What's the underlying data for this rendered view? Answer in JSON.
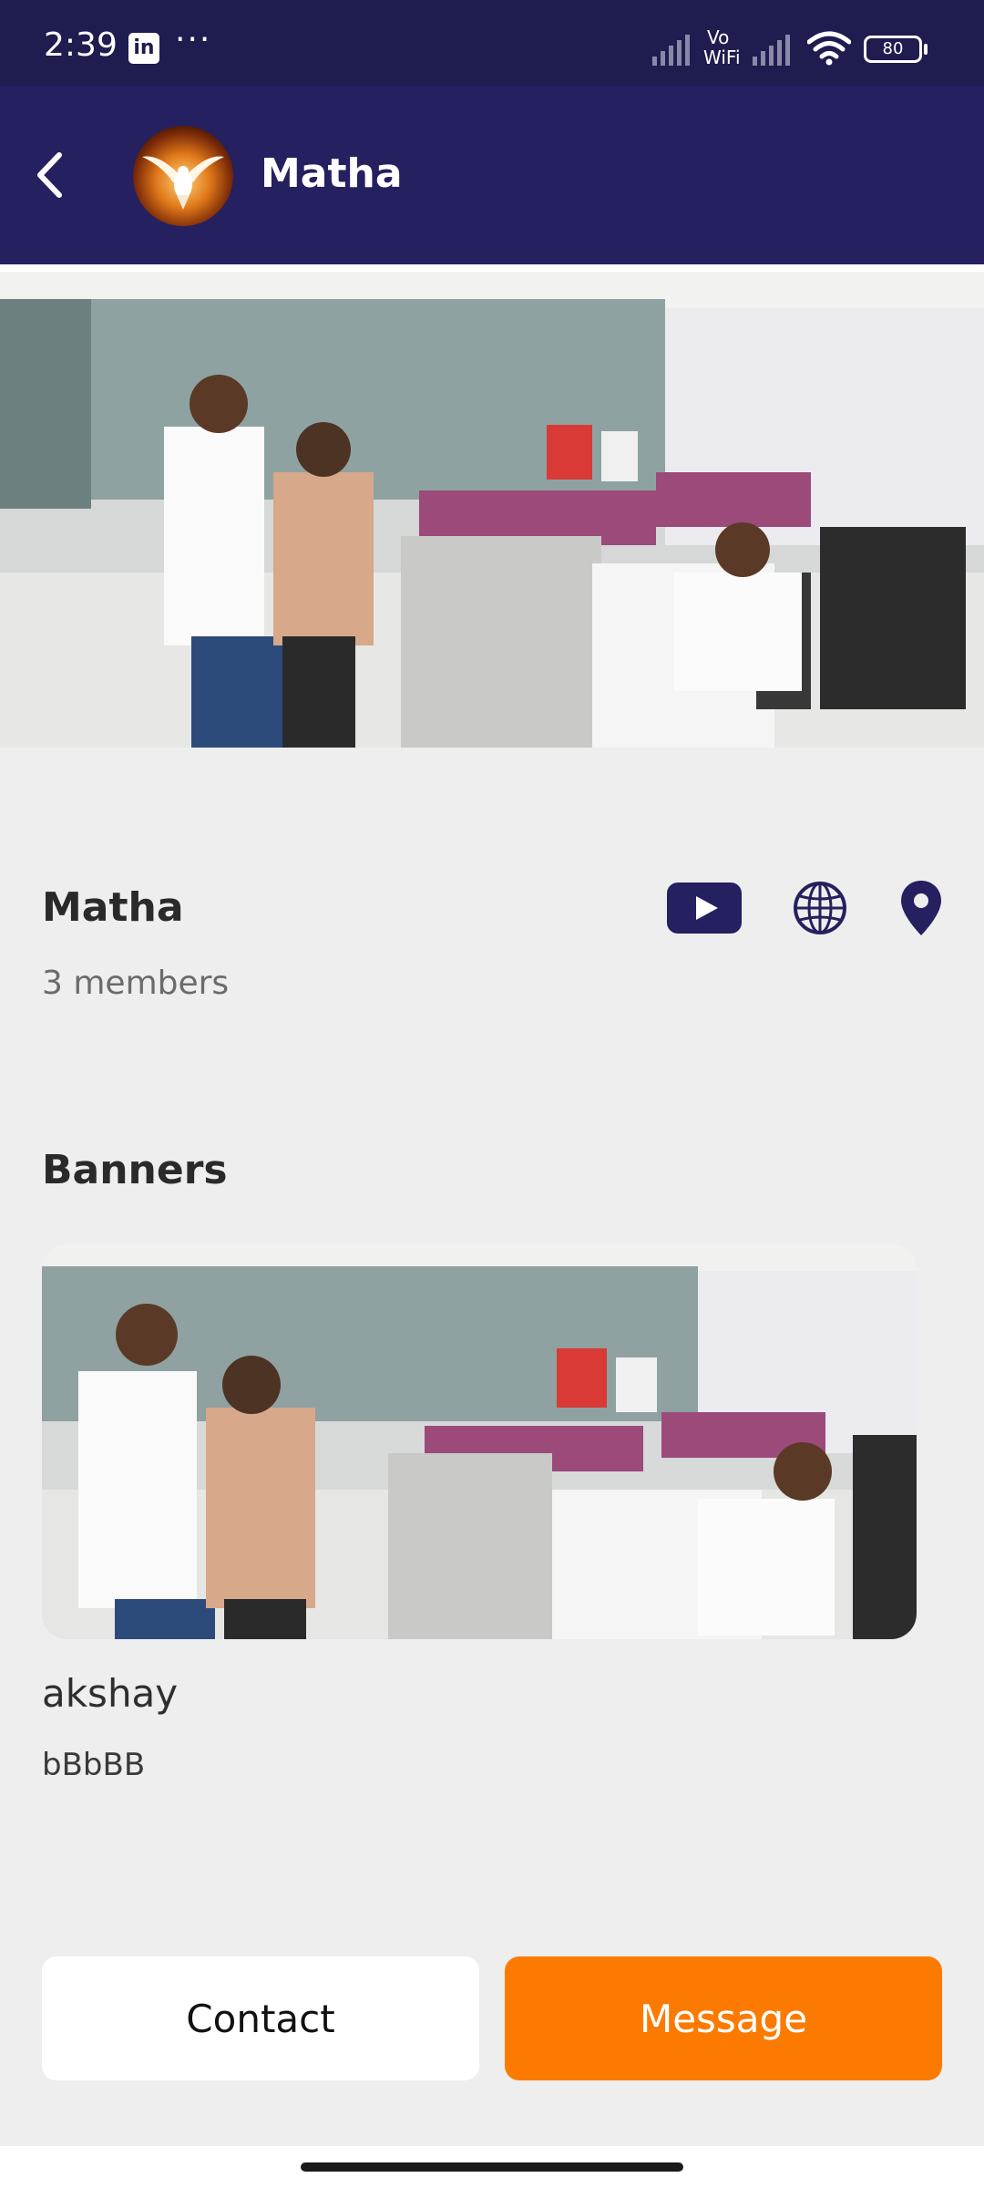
{
  "status_bar": {
    "time": "2:39",
    "notification_app": "in",
    "more": "···",
    "network_label_top": "Vo",
    "network_label_bottom": "WiFi",
    "battery": "80"
  },
  "header": {
    "title": "Matha",
    "back_icon": "chevron-left-icon",
    "avatar_icon": "dove-avatar"
  },
  "profile": {
    "name": "Matha",
    "members": "3 members",
    "actions": [
      {
        "icon": "youtube-icon"
      },
      {
        "icon": "globe-icon"
      },
      {
        "icon": "location-pin-icon"
      }
    ]
  },
  "banners": {
    "section_title": "Banners",
    "items": [
      {
        "title": "akshay",
        "description": "bBbBB"
      }
    ]
  },
  "actions": {
    "contact_label": "Contact",
    "message_label": "Message"
  },
  "colors": {
    "status_bar": "#1f1c4f",
    "app_bar": "#25205f",
    "accent": "#fc7a00",
    "icon": "#25205f",
    "background": "#eeeeee"
  }
}
